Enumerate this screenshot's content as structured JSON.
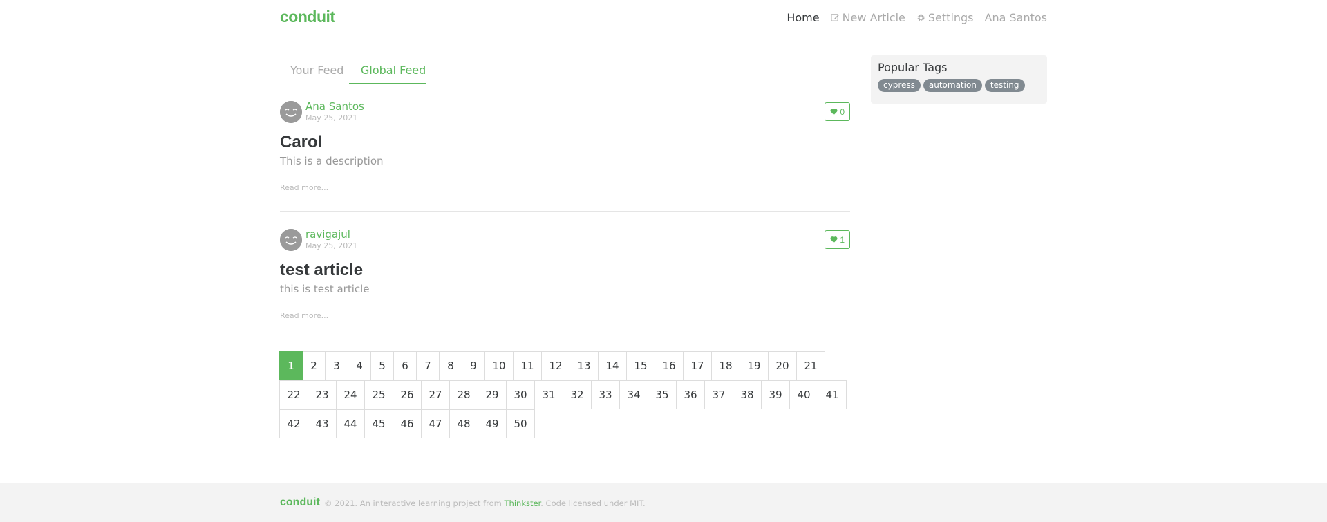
{
  "navbar": {
    "brand": "conduit",
    "items": [
      {
        "label": "Home",
        "icon": null,
        "active": true
      },
      {
        "label": "New Article",
        "icon": "edit-icon",
        "active": false
      },
      {
        "label": "Settings",
        "icon": "gear-icon",
        "active": false
      },
      {
        "label": "Ana Santos",
        "icon": null,
        "active": false
      }
    ]
  },
  "feed": {
    "tabs": [
      {
        "label": "Your Feed",
        "active": false
      },
      {
        "label": "Global Feed",
        "active": true
      }
    ],
    "articles": [
      {
        "author": "Ana Santos",
        "date": "May 25, 2021",
        "favorites": "0",
        "title": "Carol",
        "description": "This is a description",
        "read_more": "Read more..."
      },
      {
        "author": "ravigajul",
        "date": "May 25, 2021",
        "favorites": "1",
        "title": "test article",
        "description": "this is test article",
        "read_more": "Read more..."
      }
    ]
  },
  "pagination": {
    "pages": [
      "1",
      "2",
      "3",
      "4",
      "5",
      "6",
      "7",
      "8",
      "9",
      "10",
      "11",
      "12",
      "13",
      "14",
      "15",
      "16",
      "17",
      "18",
      "19",
      "20",
      "21",
      "22",
      "23",
      "24",
      "25",
      "26",
      "27",
      "28",
      "29",
      "30",
      "31",
      "32",
      "33",
      "34",
      "35",
      "36",
      "37",
      "38",
      "39",
      "40",
      "41",
      "42",
      "43",
      "44",
      "45",
      "46",
      "47",
      "48",
      "49",
      "50"
    ],
    "active_page": "1"
  },
  "sidebar": {
    "title": "Popular Tags",
    "tags": [
      "cypress",
      "automation",
      "testing"
    ]
  },
  "footer": {
    "brand": "conduit",
    "text_before": "© 2021. An interactive learning project from ",
    "link": "Thinkster",
    "text_after": ". Code licensed under MIT."
  },
  "colors": {
    "accent": "#5cb85c",
    "tag_bg": "#818a91",
    "footer_bg": "#f3f3f3"
  }
}
